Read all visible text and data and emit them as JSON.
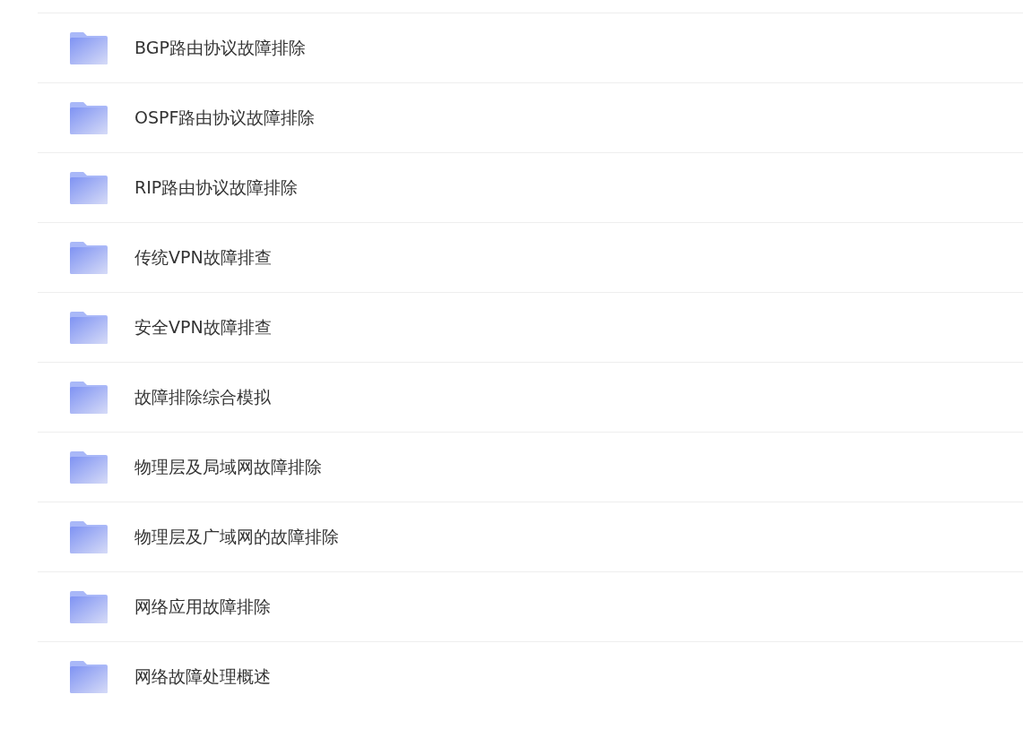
{
  "folders": [
    {
      "name": "BGP路由协议故障排除"
    },
    {
      "name": "OSPF路由协议故障排除"
    },
    {
      "name": "RIP路由协议故障排除"
    },
    {
      "name": "传统VPN故障排查"
    },
    {
      "name": "安全VPN故障排查"
    },
    {
      "name": "故障排除综合模拟"
    },
    {
      "name": "物理层及局域网故障排除"
    },
    {
      "name": "物理层及广域网的故障排除"
    },
    {
      "name": "网络应用故障排除"
    },
    {
      "name": "网络故障处理概述"
    }
  ]
}
